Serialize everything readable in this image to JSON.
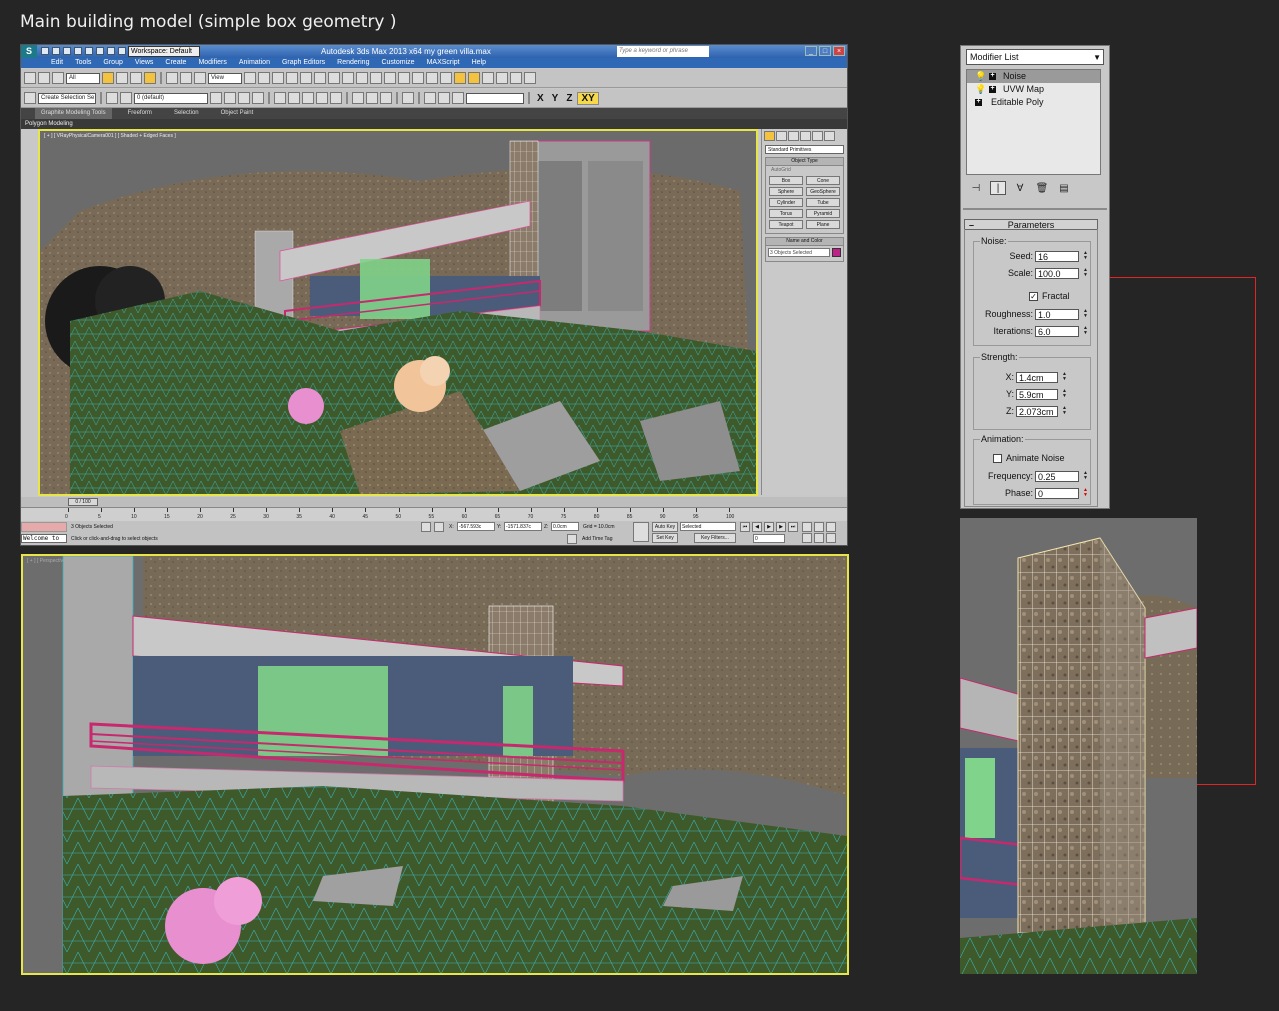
{
  "caption": "Main building model (simple box geometry )",
  "max": {
    "logo": "S",
    "workspace": "Workspace: Default",
    "title": "Autodesk 3ds Max  2013 x64      my green villa.max",
    "search_placeholder": "Type a keyword or phrase",
    "menus": [
      "Edit",
      "Tools",
      "Group",
      "Views",
      "Create",
      "Modifiers",
      "Animation",
      "Graph Editors",
      "Rendering",
      "Customize",
      "MAXScript",
      "Help"
    ],
    "toolbar1": {
      "filter": "All",
      "view": "View"
    },
    "toolbar2": {
      "selection_set": "Create Selection Se",
      "layer": "0 (default)",
      "axes": [
        "X",
        "Y",
        "Z",
        "XY"
      ]
    },
    "ribbon_tabs": [
      "Graphite Modeling Tools",
      "Freeform",
      "Selection",
      "Object Paint"
    ],
    "ribbon_sub": "Polygon Modeling",
    "viewport1_label": "[ + ] [ VRayPhysicalCamera001 ] [ Shaded + Edged Faces ]",
    "command_panel": {
      "category": "Standard Primitives",
      "object_type_title": "Object Type",
      "autogrid": "AutoGrid",
      "buttons": [
        "Box",
        "Cone",
        "Sphere",
        "GeoSphere",
        "Cylinder",
        "Tube",
        "Torus",
        "Pyramid",
        "Teapot",
        "Plane"
      ],
      "name_color_title": "Name and Color",
      "name_field": "3 Objects Selected",
      "color": "#c0208a"
    },
    "time_slider": "0 / 100",
    "ticks": [
      "0",
      "5",
      "10",
      "15",
      "20",
      "25",
      "30",
      "35",
      "40",
      "45",
      "50",
      "55",
      "60",
      "65",
      "70",
      "75",
      "80",
      "85",
      "90",
      "95",
      "100"
    ],
    "status": {
      "welcome": "Welcome to",
      "selected": "3 Objects Selected",
      "prompt": "Click or click-and-drag to select objects",
      "x": "-567.593c",
      "y": "-1571.837c",
      "z": "0.0cm",
      "grid": "Grid = 10.0cm",
      "add_time_tag": "Add Time Tag",
      "auto_key": "Auto Key",
      "set_key": "Set Key",
      "selected_dd": "Selected",
      "key_filters": "Key Filters...",
      "frame": "0"
    }
  },
  "viewport2_label": "[ + ] [ Perspective ] [ Shaded + Edged Faces ]",
  "modifier": {
    "list_label": "Modifier List",
    "stack": [
      {
        "name": "Noise",
        "selected": true
      },
      {
        "name": "UVW Map",
        "selected": false
      },
      {
        "name": "Editable Poly",
        "selected": false
      }
    ],
    "rollout_title": "Parameters",
    "noise_group": "Noise:",
    "seed_label": "Seed:",
    "seed": "16",
    "scale_label": "Scale:",
    "scale": "100.0",
    "fractal_label": "Fractal",
    "fractal_checked": true,
    "roughness_label": "Roughness:",
    "roughness": "1.0",
    "iterations_label": "Iterations:",
    "iterations": "6.0",
    "strength_group": "Strength:",
    "x_label": "X:",
    "x": "1.4cm",
    "y_label": "Y:",
    "y": "5.9cm",
    "z_label": "Z:",
    "z": "2.073cm",
    "animation_group": "Animation:",
    "animate_noise_label": "Animate Noise",
    "animate_noise_checked": false,
    "frequency_label": "Frequency:",
    "frequency": "0.25",
    "phase_label": "Phase:",
    "phase": "0"
  },
  "colors": {
    "accent_viewport_border": "#e6e64a",
    "connector": "#e02525",
    "railing": "#c8286e",
    "glass": "#7fd38a"
  }
}
